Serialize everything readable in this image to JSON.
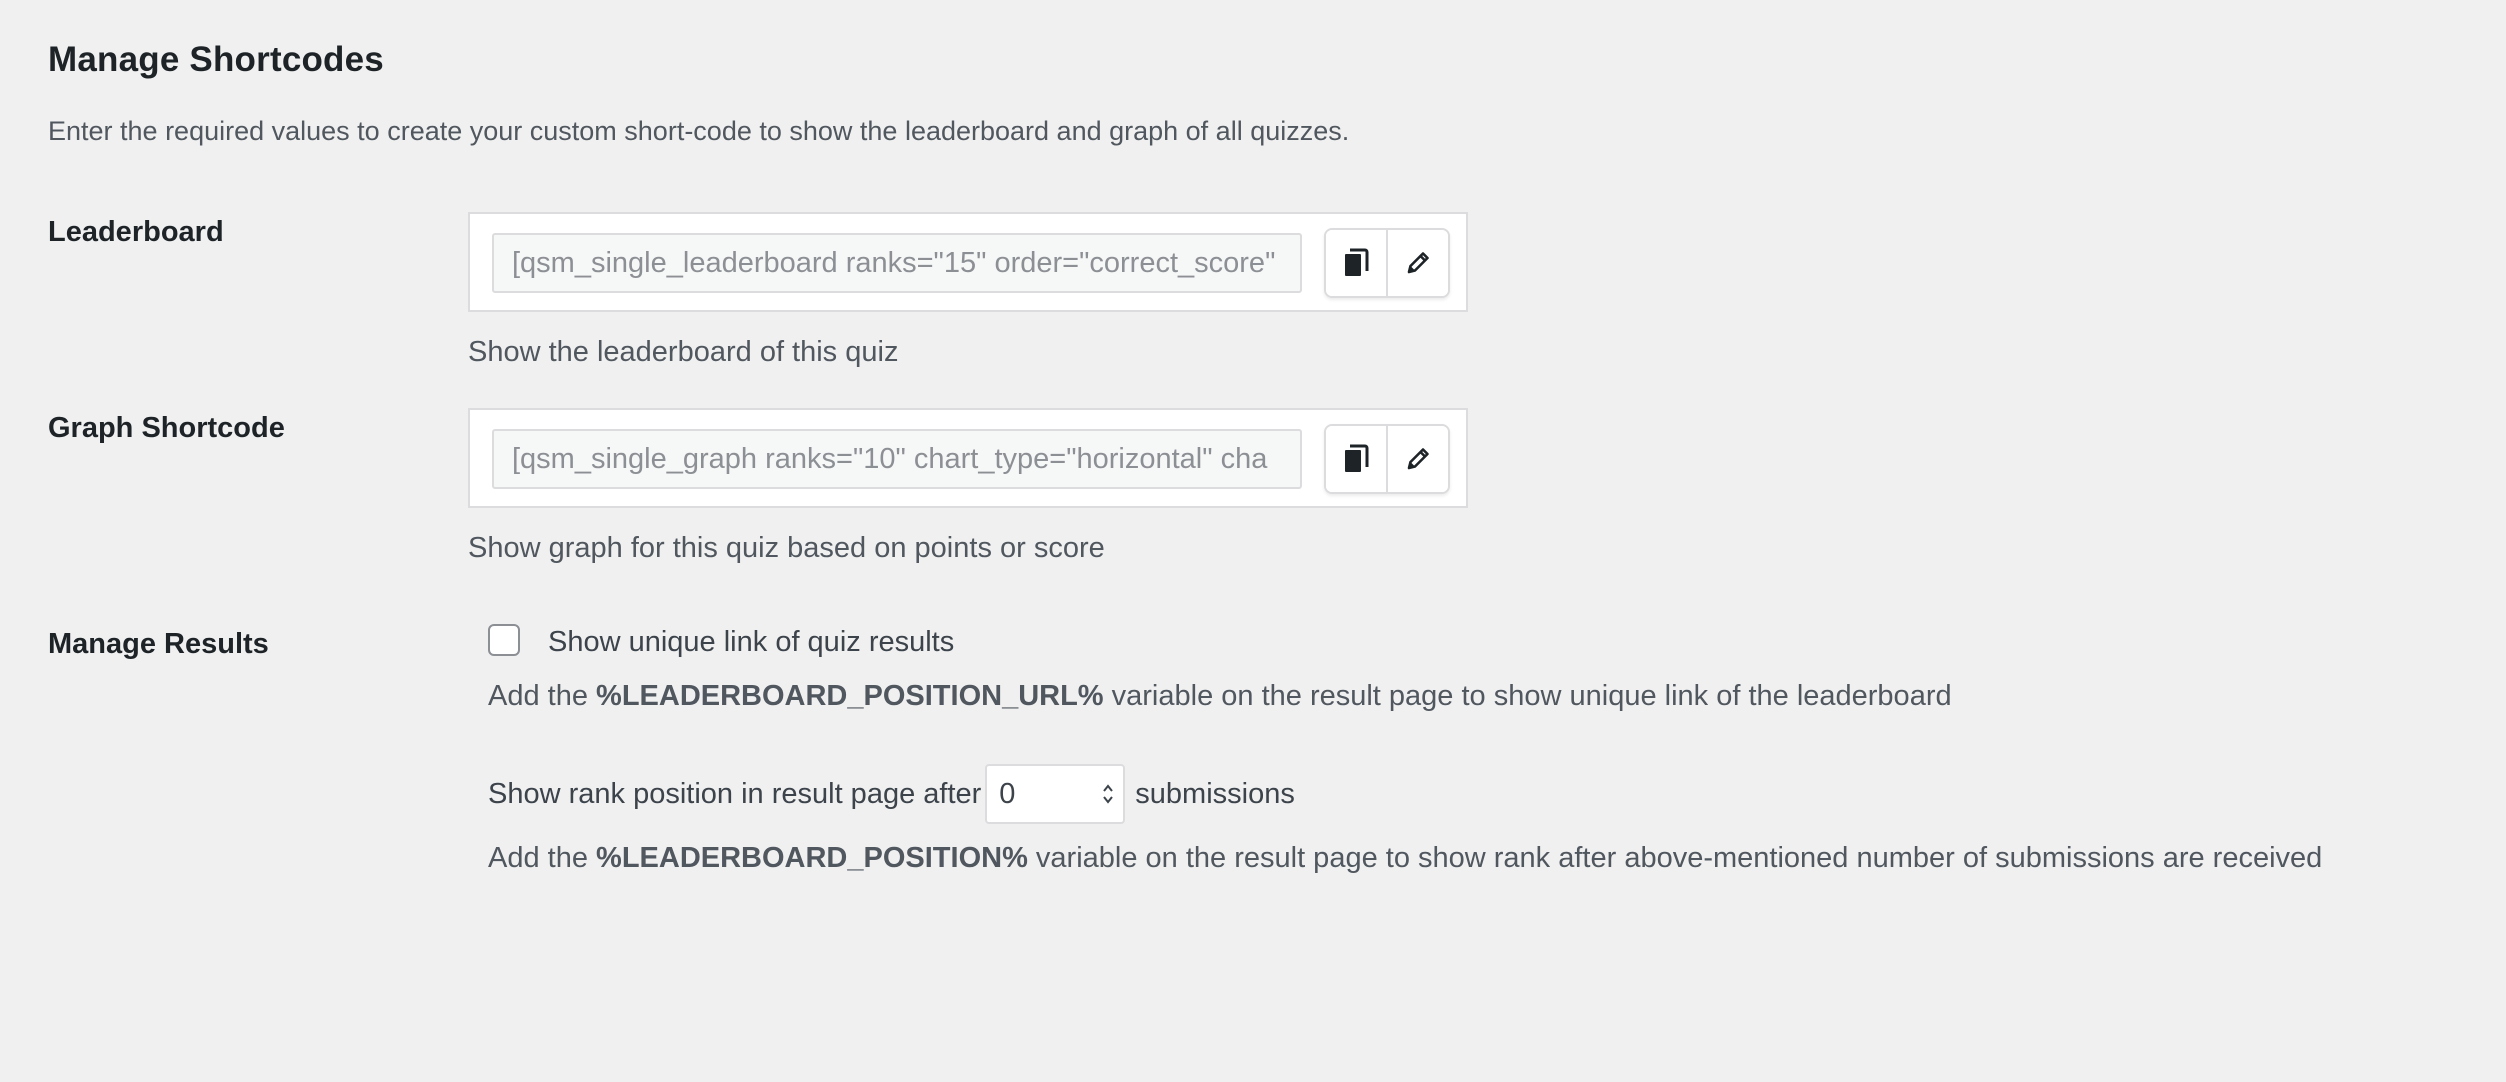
{
  "page": {
    "title": "Manage Shortcodes",
    "description": "Enter the required values to create your custom short-code to show the leaderboard and graph of all quizzes."
  },
  "leaderboard": {
    "label": "Leaderboard",
    "shortcode": "[qsm_single_leaderboard ranks=\"15\" order=\"correct_score\"",
    "help": "Show the leaderboard of this quiz",
    "icons": [
      "copy-icon",
      "edit-pencil-icon"
    ]
  },
  "graph": {
    "label": "Graph Shortcode",
    "shortcode": "[qsm_single_graph ranks=\"10\" chart_type=\"horizontal\" cha",
    "help": "Show graph for this quiz based on points or score",
    "icons": [
      "copy-icon",
      "edit-pencil-icon"
    ]
  },
  "results": {
    "label": "Manage Results",
    "checkbox_label": "Show unique link of quiz results",
    "checkbox_checked": false,
    "url_note_prefix": "Add the ",
    "url_note_var": "%LEADERBOARD_POSITION_URL%",
    "url_note_suffix": " variable on the result page to show unique link of the leaderboard",
    "rank_prefix": "Show rank position in result page after",
    "rank_value": "0",
    "rank_suffix": "submissions",
    "pos_note_prefix": "Add the ",
    "pos_note_var": "%LEADERBOARD_POSITION%",
    "pos_note_suffix": " variable on the result page to show rank after above-mentioned number of submissions are received"
  }
}
